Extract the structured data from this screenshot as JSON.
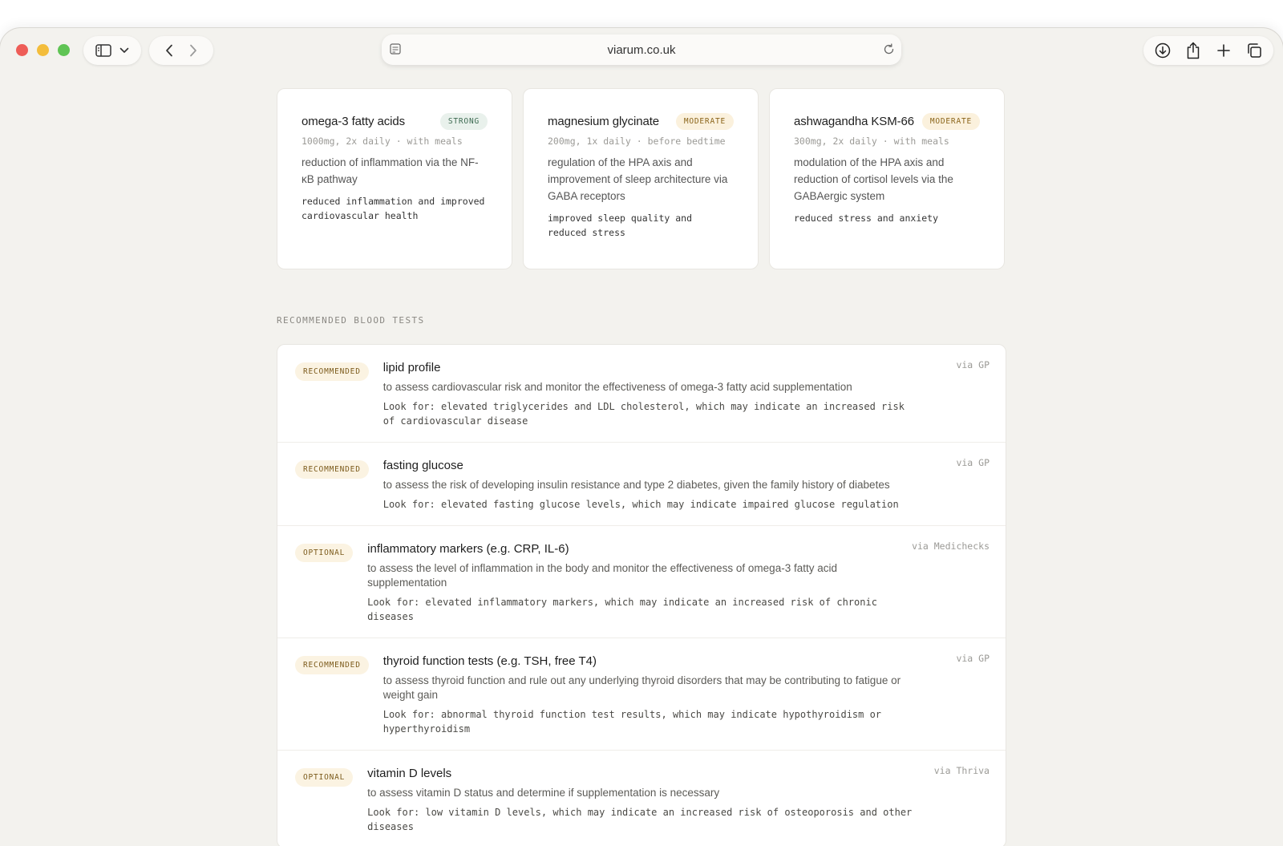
{
  "browser": {
    "url": "viarum.co.uk"
  },
  "supplements": [
    {
      "name": "omega-3 fatty acids",
      "evidence": "STRONG",
      "dose": "1000mg, 2x daily · with meals",
      "mechanism": "reduction of inflammation via the NF-κB pathway",
      "benefit": "reduced inflammation and improved cardiovascular health"
    },
    {
      "name": "magnesium glycinate",
      "evidence": "MODERATE",
      "dose": "200mg, 1x daily · before bedtime",
      "mechanism": "regulation of the HPA axis and improvement of sleep architecture via GABA receptors",
      "benefit": "improved sleep quality and reduced stress"
    },
    {
      "name": "ashwagandha KSM-66",
      "evidence": "MODERATE",
      "dose": "300mg, 2x daily · with meals",
      "mechanism": "modulation of the HPA axis and reduction of cortisol levels via the GABAergic system",
      "benefit": "reduced stress and anxiety"
    }
  ],
  "blood_tests": {
    "section_label": "RECOMMENDED BLOOD TESTS",
    "items": [
      {
        "priority": "RECOMMENDED",
        "name": "lipid profile",
        "source": "via GP",
        "purpose": "to assess cardiovascular risk and monitor the effectiveness of omega-3 fatty acid supplementation",
        "look_for": "Look for: elevated triglycerides and LDL cholesterol, which may indicate an increased risk of cardiovascular disease"
      },
      {
        "priority": "RECOMMENDED",
        "name": "fasting glucose",
        "source": "via GP",
        "purpose": "to assess the risk of developing insulin resistance and type 2 diabetes, given the family history of diabetes",
        "look_for": "Look for: elevated fasting glucose levels, which may indicate impaired glucose regulation"
      },
      {
        "priority": "OPTIONAL",
        "name": "inflammatory markers (e.g. CRP, IL-6)",
        "source": "via Medichecks",
        "purpose": "to assess the level of inflammation in the body and monitor the effectiveness of omega-3 fatty acid supplementation",
        "look_for": "Look for: elevated inflammatory markers, which may indicate an increased risk of chronic diseases"
      },
      {
        "priority": "RECOMMENDED",
        "name": "thyroid function tests (e.g. TSH, free T4)",
        "source": "via GP",
        "purpose": "to assess thyroid function and rule out any underlying thyroid disorders that may be contributing to fatigue or weight gain",
        "look_for": "Look for: abnormal thyroid function test results, which may indicate hypothyroidism or hyperthyroidism"
      },
      {
        "priority": "OPTIONAL",
        "name": "vitamin D levels",
        "source": "via Thriva",
        "purpose": "to assess vitamin D status and determine if supplementation is necessary",
        "look_for": "Look for: low vitamin D levels, which may indicate an increased risk of osteoporosis and other diseases"
      }
    ]
  },
  "colors": {
    "strong_badge": "#3d6b52",
    "moderate_badge": "#8a6419",
    "page_bg": "#f3f2ee"
  }
}
